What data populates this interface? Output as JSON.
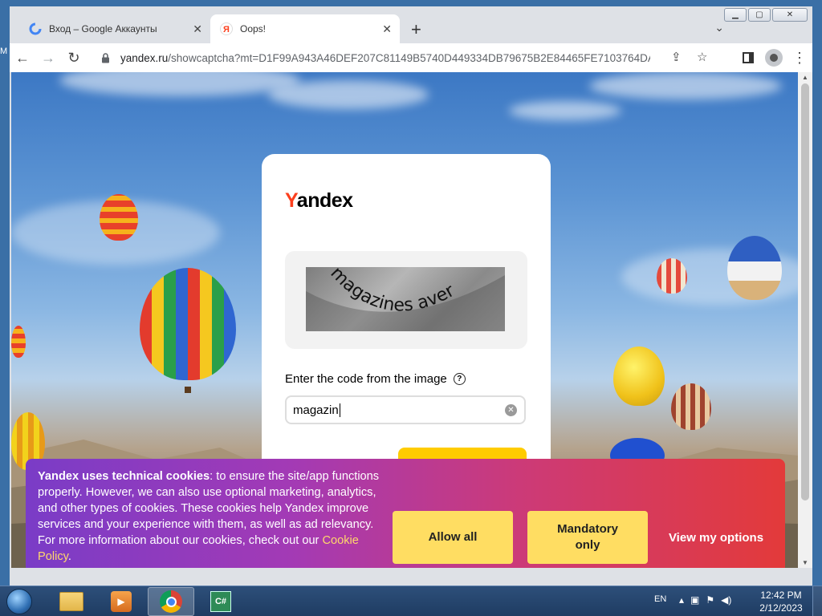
{
  "browser": {
    "tabs": [
      {
        "title": "Вход – Google Аккаунты",
        "icon": "google-g-icon"
      },
      {
        "title": "Oops!",
        "icon": "yandex-icon"
      }
    ],
    "url_domain": "yandex.ru",
    "url_path": "/showcaptcha?mt=D1F99A943A46DEF207C81149B5740D449334DB79675B2E84465FE7103764DA..."
  },
  "page": {
    "logo_first": "Y",
    "logo_rest": "andex",
    "captcha_text": "magazines aver",
    "enter_label": "Enter the code from the image",
    "help_glyph": "?",
    "input_value": "magazin"
  },
  "cookie": {
    "bold_lead": "Yandex uses technical cookies",
    "body": ": to ensure the site/app functions properly. However, we can also use optional marketing, analytics, and other types of cookies. These cookies help Yandex improve services and your experience with them, as well as ad relevancy. For more information about our cookies, check out our ",
    "link": "Cookie Policy",
    "tail": ".",
    "allow_all": "Allow all",
    "mandatory_line1": "Mandatory",
    "mandatory_line2": "only",
    "view_options": "View my options"
  },
  "taskbar": {
    "language": "EN",
    "time": "12:42 PM",
    "date": "2/12/2023",
    "cs_label": "C#"
  },
  "colors": {
    "yandex_red": "#fc3f1d",
    "button_yellow": "#ffdd62",
    "banner_start": "#7a3cc7",
    "banner_end": "#e33a3a"
  }
}
